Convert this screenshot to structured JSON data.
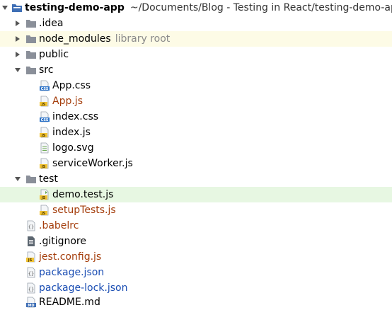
{
  "root": {
    "name": "testing-demo-app",
    "path": "~/Documents/Blog - Testing in React/testing-demo-app"
  },
  "items": [
    {
      "label": ".idea",
      "type": "folder",
      "collapsed": true
    },
    {
      "label": "node_modules",
      "type": "folder",
      "collapsed": true,
      "suffix": "library root"
    },
    {
      "label": "public",
      "type": "folder",
      "collapsed": true
    },
    {
      "label": "src",
      "type": "folder",
      "collapsed": false
    },
    {
      "label": "App.css",
      "type": "css"
    },
    {
      "label": "App.js",
      "type": "js"
    },
    {
      "label": "index.css",
      "type": "css"
    },
    {
      "label": "index.js",
      "type": "js"
    },
    {
      "label": "logo.svg",
      "type": "svg"
    },
    {
      "label": "serviceWorker.js",
      "type": "js"
    },
    {
      "label": "test",
      "type": "folder",
      "collapsed": false
    },
    {
      "label": "demo.test.js",
      "type": "js"
    },
    {
      "label": "setupTests.js",
      "type": "js"
    },
    {
      "label": ".babelrc",
      "type": "json"
    },
    {
      "label": ".gitignore",
      "type": "text"
    },
    {
      "label": "jest.config.js",
      "type": "js"
    },
    {
      "label": "package.json",
      "type": "json"
    },
    {
      "label": "package-lock.json",
      "type": "json"
    },
    {
      "label": "README.md",
      "type": "md"
    }
  ],
  "colors": {
    "folder": "#8a8f99",
    "js_badge": "#f1c232",
    "css_badge": "#2d73c8",
    "modified_blue": "#1a4db3",
    "unversioned_orange": "#a43d0b",
    "highlight_green": "#e7f7e2",
    "highlight_yellow": "#fdfbe6"
  }
}
